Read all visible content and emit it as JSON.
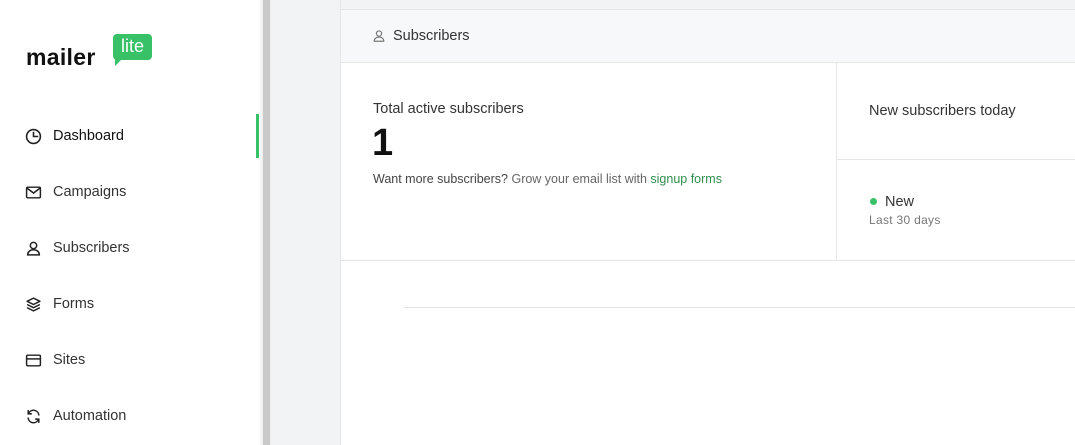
{
  "logo": {
    "word": "mailer",
    "badge": "lite",
    "accent": "#39c168"
  },
  "sidebar": {
    "items": [
      {
        "label": "Dashboard",
        "icon": "dashboard-icon",
        "active": true
      },
      {
        "label": "Campaigns",
        "icon": "mail-icon"
      },
      {
        "label": "Subscribers",
        "icon": "user-icon"
      },
      {
        "label": "Forms",
        "icon": "layers-icon"
      },
      {
        "label": "Sites",
        "icon": "browser-icon"
      },
      {
        "label": "Automation",
        "icon": "refresh-icon"
      }
    ]
  },
  "section": {
    "title": "Subscribers",
    "icon": "user-icon"
  },
  "total": {
    "label": "Total active subscribers",
    "value": "1",
    "hint_question": "Want more subscribers?",
    "hint_text": " Grow your email list with ",
    "hint_link": "signup forms"
  },
  "today": {
    "label": "New subscribers today",
    "legend_label": "New",
    "legend_sub": "Last 30 days",
    "legend_color": "#39c168"
  }
}
